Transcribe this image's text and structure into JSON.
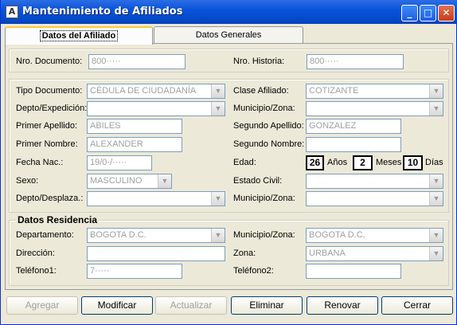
{
  "window": {
    "title": "Mantenimiento de Afiliados"
  },
  "tabs": [
    {
      "label": "Datos del Afiliado",
      "active": true
    },
    {
      "label": "Datos Generales",
      "active": false
    }
  ],
  "header": {
    "nro_documento_label": "Nro. Documento:",
    "nro_documento_value": "800·····",
    "nro_historia_label": "Nro. Historia:",
    "nro_historia_value": "800·····"
  },
  "afiliado": {
    "tipo_documento_label": "Tipo Documento:",
    "tipo_documento_value": "CÉDULA DE CIUDADANÍA",
    "clase_afiliado_label": "Clase Afiliado:",
    "clase_afiliado_value": "COTIZANTE",
    "depto_expedicion_label": "Depto/Expedición:",
    "depto_expedicion_value": "",
    "municipio_zona_label": "Municipio/Zona:",
    "municipio_zona_value": "",
    "primer_apellido_label": "Primer Apellido:",
    "primer_apellido_value": "ABILES",
    "segundo_apellido_label": "Segundo Apellido:",
    "segundo_apellido_value": "GONZALEZ",
    "primer_nombre_label": "Primer Nombre:",
    "primer_nombre_value": "ALEXANDER",
    "segundo_nombre_label": "Segundo Nombre:",
    "segundo_nombre_value": "",
    "fecha_nac_label": "Fecha Nac.:",
    "fecha_nac_value": "19/0·/·····",
    "edad_label": "Edad:",
    "edad_anos": "26",
    "anos_label": "Años",
    "edad_meses": "2",
    "meses_label": "Meses",
    "edad_dias": "10",
    "dias_label": "Días",
    "sexo_label": "Sexo:",
    "sexo_value": "MASCULINO",
    "estado_civil_label": "Estado Civil:",
    "estado_civil_value": "",
    "depto_desplaza_label": "Depto/Desplaza.:",
    "depto_desplaza_value": "",
    "municipio_zona2_label": "Municipio/Zona:",
    "municipio_zona2_value": ""
  },
  "residencia": {
    "title": "Datos Residencia",
    "departamento_label": "Departamento:",
    "departamento_value": "BOGOTA D.C.",
    "municipio_zona_label": "Municipio/Zona:",
    "municipio_zona_value": "BOGOTA D.C.",
    "direccion_label": "Dirección:",
    "direccion_value": "",
    "zona_label": "Zona:",
    "zona_value": "URBANA",
    "telefono1_label": "Teléfono1:",
    "telefono1_value": "7·····",
    "telefono2_label": "Teléfono2:",
    "telefono2_value": ""
  },
  "buttons": {
    "agregar": "Agregar",
    "modificar": "Modificar",
    "actualizar": "Actualizar",
    "eliminar": "Eliminar",
    "renovar": "Renovar",
    "cerrar": "Cerrar"
  },
  "icons": {
    "app": "app-icon",
    "minimize": "minimize-icon",
    "maximize": "maximize-icon",
    "close": "close-icon"
  },
  "colors": {
    "titlebar": "#0a53d9",
    "window_bg": "#ece9d8",
    "tab_highlight": "#ffc83c"
  }
}
